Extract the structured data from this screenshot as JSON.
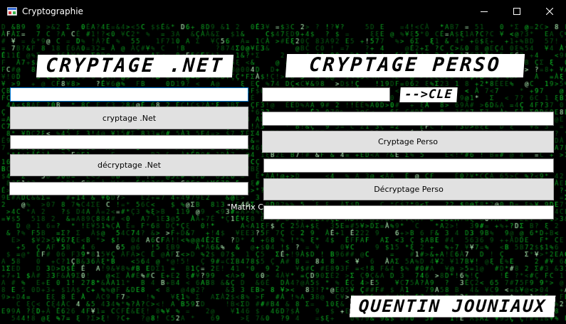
{
  "window": {
    "title": "Cryptographie",
    "controls": {
      "minimize": "minimize-icon",
      "maximize": "maximize-icon",
      "close": "close-icon"
    }
  },
  "banners": {
    "net_title": "CRYPTAGE .NET",
    "perso_title": "CRYPTAGE PERSO",
    "key_label": "-->CLE",
    "author": "QUENTIN JOUNIAUX"
  },
  "net_section": {
    "input_value": "",
    "encrypt_button": "cryptage .Net",
    "encrypted_value": "",
    "decrypt_button": "décryptage .Net",
    "decrypted_value": ""
  },
  "perso_section": {
    "key_value": "",
    "input_value": "",
    "encrypt_button": "Cryptage Perso",
    "encrypted_value": "",
    "decrypt_button": "Décryptage Perso",
    "decrypted_value": ""
  },
  "status": {
    "label": "\"Matrix C"
  },
  "colors": {
    "matrix_green": "#0fd12a",
    "background": "#000000",
    "banner_bg": "#ffffff",
    "button_bg": "#e1e1e1"
  }
}
